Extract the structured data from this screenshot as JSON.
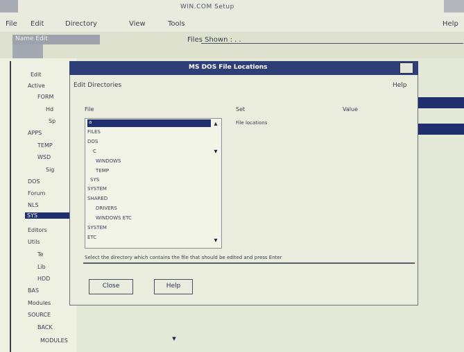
{
  "window": {
    "title": "WIN.COM Setup",
    "help_label": "Help"
  },
  "menu": {
    "items": [
      "File",
      "Edit",
      "Directory",
      "View",
      "Tools"
    ],
    "help": "Help"
  },
  "toolbar": {
    "label": "Name Edit",
    "filter_label": "Files Shown : . ."
  },
  "tree": {
    "items": [
      {
        "label": "Edit"
      },
      {
        "label": "Active"
      },
      {
        "label": "FORM"
      },
      {
        "label": "Hd"
      },
      {
        "label": "Sp"
      },
      {
        "label": "APPS"
      },
      {
        "label": "TEMP"
      },
      {
        "label": "WSD"
      },
      {
        "label": "Sig"
      },
      {
        "label": "DOS"
      },
      {
        "label": "Forum"
      },
      {
        "label": "NLS"
      },
      {
        "label": "SYS",
        "selected": true
      },
      {
        "label": "Editors"
      },
      {
        "label": "Utils"
      },
      {
        "label": "Te"
      },
      {
        "label": "Lib"
      },
      {
        "label": "HDD"
      },
      {
        "label": "BAS"
      },
      {
        "label": "Modules"
      },
      {
        "label": "SOURCE"
      },
      {
        "label": "BACK"
      },
      {
        "label": "MODULES"
      }
    ]
  },
  "dialog": {
    "title": "MS DOS File Locations",
    "subtitle": "Edit Directories",
    "help": "Help",
    "list_heading": "File",
    "right_heading": "Set",
    "right_value": "File locations",
    "right_note": "Value",
    "list_items": [
      "a",
      "FILES",
      "DOS",
      "C",
      "WINDOWS",
      "TEMP",
      "SYS",
      "SYSTEM",
      "SHARED",
      "DRIVERS",
      "WINDOWS ETC",
      "SYSTEM",
      "ETC"
    ],
    "status_text": "Select the directory which contains the file that should be edited and press Enter",
    "ok_label": "Close",
    "help_button": "Help"
  },
  "icons": {
    "close": "close-box-icon",
    "arrow": "scroll-arrow-icon"
  },
  "colors": {
    "selection": "#1f2f6e",
    "title_active": "#2e3f78",
    "background": "#e4e8d6"
  }
}
